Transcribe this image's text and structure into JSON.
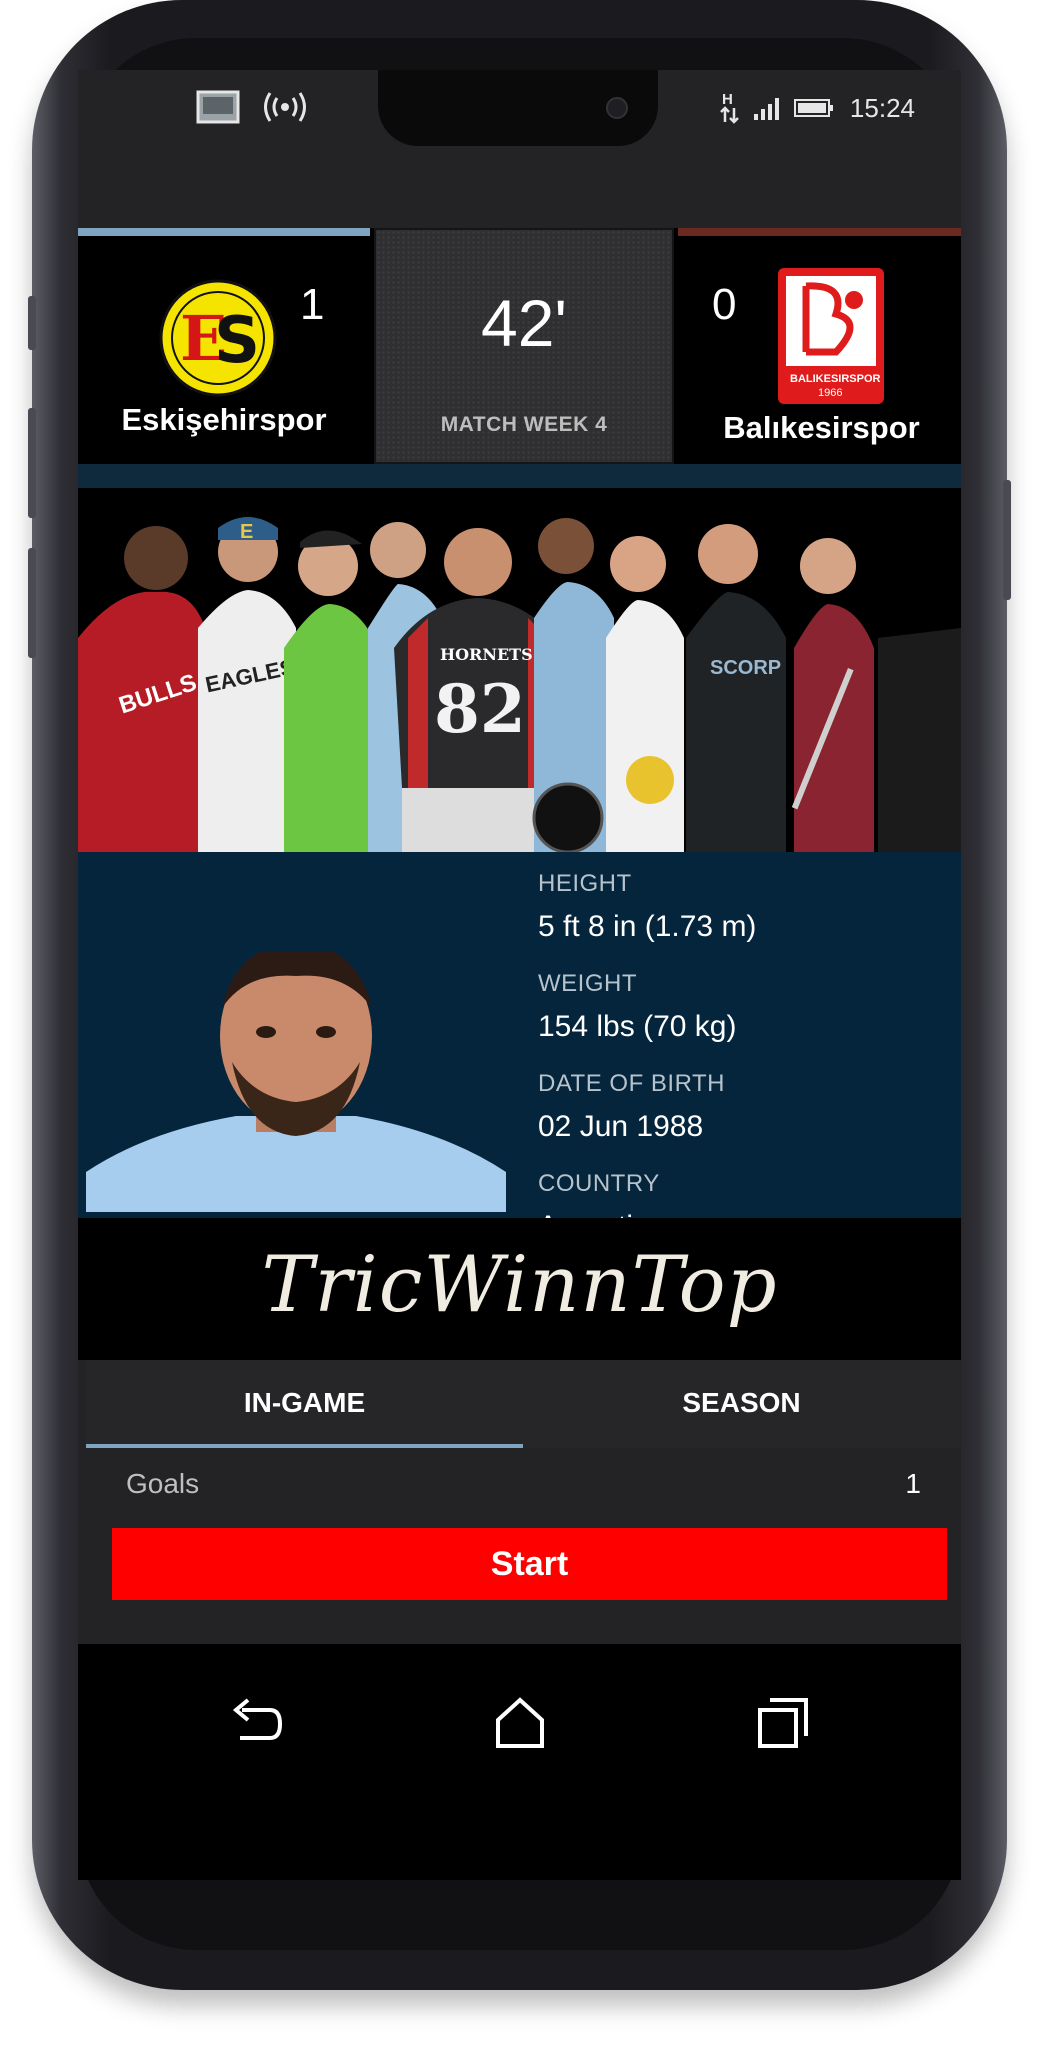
{
  "status_bar": {
    "time": "15:24",
    "icons": [
      "gallery-icon",
      "nfc-wave-icon",
      "h-data-icon",
      "signal-icon",
      "battery-icon"
    ]
  },
  "match": {
    "home_team": "Eskişehirspor",
    "home_score": "1",
    "away_team": "Balıkesirspor",
    "away_score": "0",
    "minute": "42'",
    "week_label": "MATCH WEEK 4",
    "colors": {
      "home_accent": "#7fa4c2",
      "away_accent": "#6a2a22"
    }
  },
  "player": {
    "stats": [
      {
        "label": "HEIGHT",
        "value": "5 ft 8 in (1.73 m)"
      },
      {
        "label": "WEIGHT",
        "value": "154 lbs (70 kg)"
      },
      {
        "label": "DATE OF BIRTH",
        "value": "02 Jun 1988"
      },
      {
        "label": "COUNTRY",
        "value": "Argentina"
      }
    ]
  },
  "hero": {
    "jersey_texts": [
      "HORNETS",
      "82",
      "E",
      "BULLS",
      "EAGLES",
      "SCORP"
    ]
  },
  "brand": {
    "name": "TricWinnTop"
  },
  "tabs": [
    {
      "label": "IN-GAME",
      "active": true
    },
    {
      "label": "SEASON",
      "active": false
    }
  ],
  "goals": {
    "label": "Goals",
    "value": "1"
  },
  "start_button": {
    "label": "Start",
    "color": "#ff0000"
  },
  "nav": {
    "icons": [
      "back-icon",
      "home-icon",
      "recents-icon"
    ]
  }
}
